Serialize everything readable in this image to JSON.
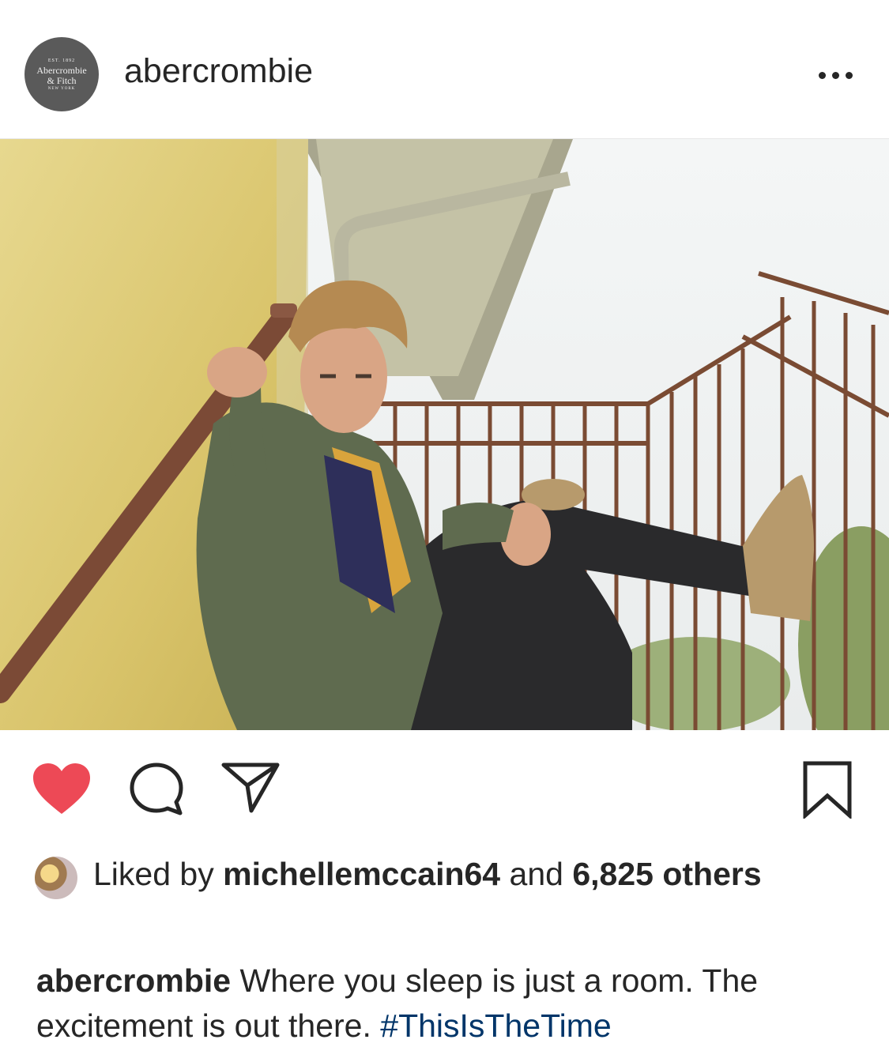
{
  "post": {
    "username": "abercrombie",
    "avatar": {
      "est": "EST. 1892",
      "brand_line1": "Abercrombie",
      "brand_line2": "& Fitch",
      "city": "NEW YORK"
    },
    "more_icon": "more-options-icon",
    "image_description_icon": "post-photo"
  },
  "actions": {
    "liked": true,
    "like_color": "#ed4956",
    "icons": [
      "heart-icon",
      "comment-icon",
      "share-icon",
      "bookmark-icon"
    ]
  },
  "likes": {
    "prefix": "Liked by",
    "first_liker": "michellemccain64",
    "and": "and",
    "count": "6,825",
    "others": "others"
  },
  "caption": {
    "username": "abercrombie",
    "text": "Where you sleep is just a room. The excitement is out there.",
    "hashtag": "#ThisIsTheTime"
  }
}
